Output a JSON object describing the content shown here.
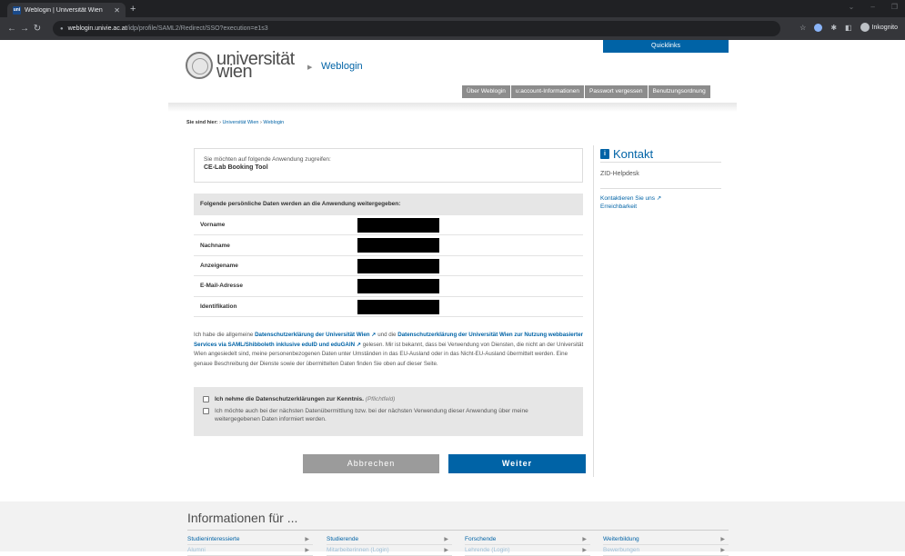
{
  "browser": {
    "tab_title": "Weblogin | Universität Wien",
    "tab_favicon_text": "uni",
    "url_host": "weblogin.univie.ac.at",
    "url_path": "/idp/profile/SAML2/Redirect/SSO?execution=e1s3",
    "profile_label": "Inkognito"
  },
  "header": {
    "quicklinks_label": "Quicklinks",
    "logo_line1": "universität",
    "logo_line2": "wien",
    "section_title": "Weblogin",
    "nav_items": [
      "Über Weblogin",
      "u:account-Informationen",
      "Passwort vergessen",
      "Benutzungsordnung"
    ]
  },
  "breadcrumb": {
    "label": "Sie sind hier:",
    "items": [
      "Universität Wien",
      "Weblogin"
    ],
    "sep": "›"
  },
  "app": {
    "intro": "Sie möchten auf folgende Anwendung zugreifen:",
    "name": "CE-Lab Booking Tool"
  },
  "data_table": {
    "header": "Folgende persönliche Daten werden an die Anwendung weitergegeben:",
    "rows": [
      "Vorname",
      "Nachname",
      "Anzeigename",
      "E-Mail-Adresse",
      "Identifikation"
    ]
  },
  "consent": {
    "part1": "Ich habe die allgemeine ",
    "link1": "Datenschutzerklärung der Universität Wien",
    "part2": " und die ",
    "link2": "Datenschutzerklärung der Universität Wien zur Nutzung webbasierter Services via SAML/Shibboleth inklusive eduID und eduGAIN",
    "part3": " gelesen. Mir ist bekannt, dass bei Verwendung von Diensten, die nicht an der Universität Wien angesiedelt sind, meine personenbezogenen Daten unter Umständen in das EU-Ausland oder in das Nicht-EU-Ausland übermittelt werden. Eine genaue Beschreibung der Dienste sowie der übermittelten Daten finden Sie oben auf dieser Seite."
  },
  "checkboxes": {
    "first_label": "Ich nehme die Datenschutzerklärungen zur Kenntnis.",
    "first_required": "(Pflichtfeld)",
    "second_label": "Ich möchte auch bei der nächsten Datenübermittlung bzw. bei der nächsten Verwendung dieser Anwendung über meine weitergegebenen Daten informiert werden."
  },
  "buttons": {
    "cancel": "Abbrechen",
    "next": "Weiter"
  },
  "sidebar": {
    "title": "Kontakt",
    "helpdesk": "ZID-Helpdesk",
    "link_contact": "Kontaktieren Sie uns",
    "link_reach": "Erreichbarkeit"
  },
  "footer": {
    "title": "Informationen für ...",
    "row1": [
      "Studieninteressierte",
      "Studierende",
      "Forschende",
      "Weiterbildung"
    ],
    "row2": [
      "Alumni",
      "Mitarbeiterinnen (Login)",
      "Lehrende (Login)",
      "Bewerbungen"
    ]
  },
  "colors": {
    "brand_blue": "#0063a6",
    "button_gray": "#9b9b9b",
    "panel_gray": "#e6e6e6"
  }
}
